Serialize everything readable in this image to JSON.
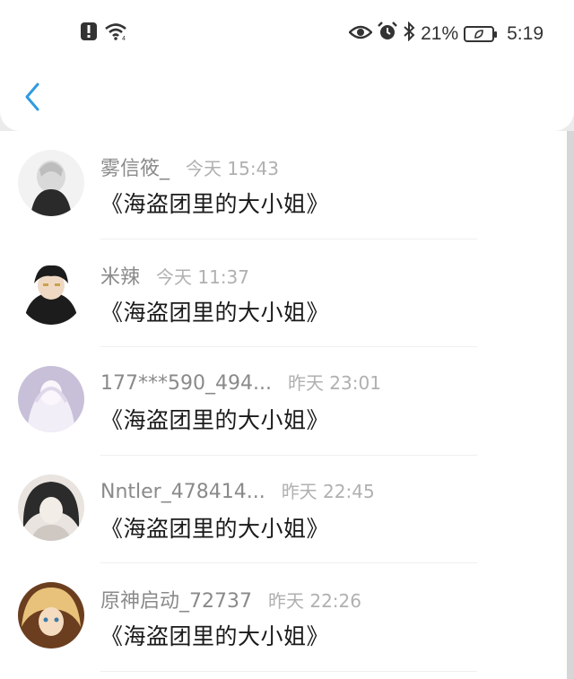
{
  "status_bar": {
    "battery_percent": "21%",
    "time": "5:19",
    "icons": [
      "alert-icon",
      "wifi-icon",
      "eye-icon",
      "alarm-icon",
      "bluetooth-icon",
      "battery-icon"
    ]
  },
  "nav": {
    "back_icon": "chevron-left-icon",
    "accent": "#2f9be0"
  },
  "messages": [
    {
      "name": "雾信筱_",
      "time": "今天 15:43",
      "title": "《海盗团里的大小姐》",
      "avatar_colors": [
        "#d9d9d9",
        "#2a2a2a"
      ]
    },
    {
      "name": "米辣",
      "time": "今天 11:37",
      "title": "《海盗团里的大小姐》",
      "avatar_colors": [
        "#1c1c1c",
        "#c9a24a"
      ]
    },
    {
      "name": "177***590_494...",
      "time": "昨天 23:01",
      "title": "《海盗团里的大小姐》",
      "avatar_colors": [
        "#c8c0d8",
        "#f2eef7"
      ]
    },
    {
      "name": "Nntler_478414...",
      "time": "昨天 22:45",
      "title": "《海盗团里的大小姐》",
      "avatar_colors": [
        "#2b2b2b",
        "#e9e4df"
      ]
    },
    {
      "name": "原神启动_72737",
      "time": "昨天 22:26",
      "title": "《海盗团里的大小姐》",
      "avatar_colors": [
        "#6b3e1f",
        "#e8c27a"
      ]
    }
  ]
}
